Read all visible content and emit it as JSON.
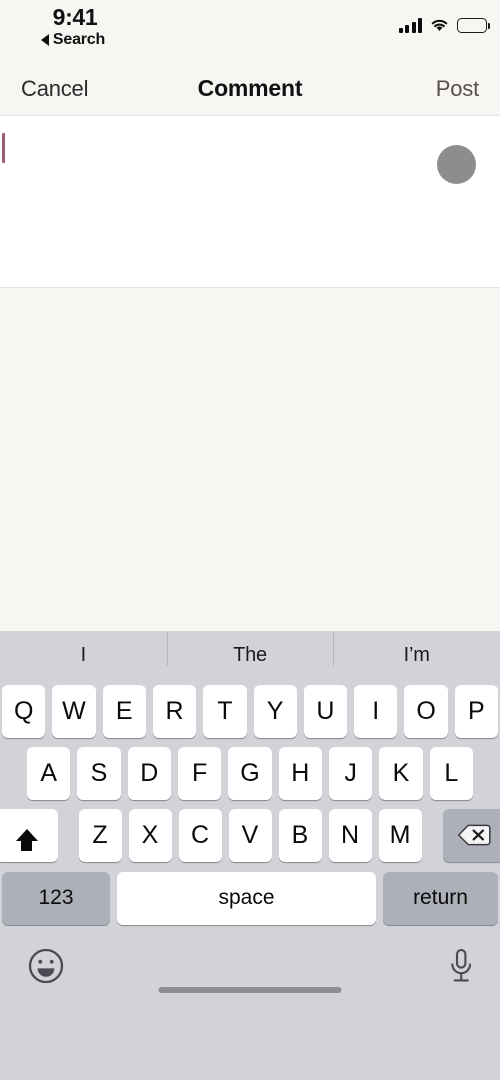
{
  "status_bar": {
    "time": "9:41",
    "back_label": "Search",
    "back_icon": "triangle-left-icon",
    "signal_icon": "cellular-signal-icon",
    "signal_bars": 4,
    "wifi_icon": "wifi-icon",
    "battery_icon": "battery-full-icon",
    "battery_level": 100
  },
  "nav_bar": {
    "cancel_label": "Cancel",
    "title": "Comment",
    "post_label": "Post"
  },
  "compose": {
    "text_value": "",
    "placeholder": "",
    "avatar_icon": "avatar-placeholder",
    "caret_color": "#9c5d6c",
    "avatar_color": "#8d8d8d"
  },
  "keyboard": {
    "predictions": [
      "I",
      "The",
      "I’m"
    ],
    "row1": [
      "Q",
      "W",
      "E",
      "R",
      "T",
      "Y",
      "U",
      "I",
      "O",
      "P"
    ],
    "row2": [
      "A",
      "S",
      "D",
      "F",
      "G",
      "H",
      "J",
      "K",
      "L"
    ],
    "row3": [
      "Z",
      "X",
      "C",
      "V",
      "B",
      "N",
      "M"
    ],
    "shift_icon": "shift-up-arrow-icon",
    "backspace_icon": "backspace-delete-icon",
    "numeric_label": "123",
    "space_label": "space",
    "return_label": "return",
    "emoji_icon": "emoji-smiley-icon",
    "dictation_icon": "microphone-icon",
    "key_bg": "#ffffff",
    "modifier_bg": "#adb0b8",
    "keyboard_bg": "#d1d3d9"
  },
  "home_indicator": {
    "label": "home-indicator",
    "color": "#8c8c92"
  }
}
